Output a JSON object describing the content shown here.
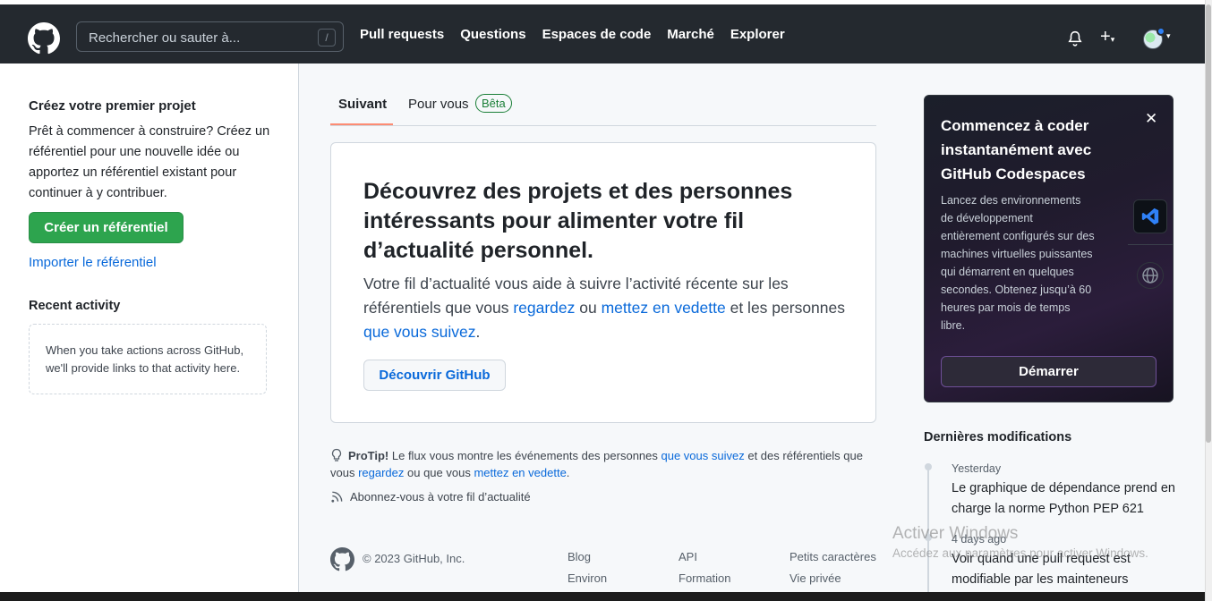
{
  "header": {
    "search_placeholder": "Rechercher ou sauter à...",
    "search_shortcut": "/",
    "nav": [
      "Pull requests",
      "Questions",
      "Espaces de code",
      "Marché",
      "Explorer"
    ],
    "plus": "+",
    "caret": "▾"
  },
  "left": {
    "title": "Créez votre premier projet",
    "text": "Prêt à commencer à construire? Créez un référentiel pour une nouvelle idée ou apportez un référentiel existant pour continuer à y contribuer.",
    "create_button": "Créer un référentiel",
    "import_link": "Importer le référentiel",
    "recent_title": "Recent activity",
    "recent_text": "When you take actions across GitHub, we'll provide links to that activity here."
  },
  "tabs": {
    "following": "Suivant",
    "for_you": "Pour vous",
    "beta": "Bêta"
  },
  "card": {
    "title": "Découvrez des projets et des personnes intéressants pour alimenter votre fil d’actualité personnel.",
    "body_1": "Votre fil d’actualité vous aide à suivre l’activité récente sur les référentiels que vous ",
    "link_watch": "regardez",
    "body_2": " ou ",
    "link_star": "mettez en vedette",
    "body_3": " et les personnes ",
    "link_follow": "que vous suivez",
    "body_4": ".",
    "button": "Découvrir GitHub"
  },
  "protip": {
    "label": "ProTip!",
    "text_1": " Le flux vous montre les événements des personnes ",
    "link_1": "que vous suivez",
    "text_2": " et des référentiels que vous ",
    "link_2": "regardez",
    "text_3": " ou que vous ",
    "link_3": "mettez en vedette",
    "text_4": ".",
    "rss": "Abonnez-vous à votre fil d’actualité"
  },
  "footer": {
    "copyright": "© 2023 GitHub, Inc.",
    "links": [
      "Blog",
      "API",
      "Petits caractères",
      "Environ",
      "Formation",
      "Vie privée"
    ]
  },
  "promo": {
    "title": "Commencez à coder instantanément avec GitHub Codespaces",
    "body": "Lancez des environnements de développement entièrement configurés sur des machines virtuelles puissantes qui démarrent en quelques secondes. Obtenez jusqu’à 60 heures par mois de temps libre.",
    "close": "✕",
    "button": "Démarrer"
  },
  "changes": {
    "title": "Dernières modifications",
    "items": [
      {
        "date": "Yesterday",
        "text": "Le graphique de dépendance prend en charge la norme Python PEP 621"
      },
      {
        "date": "4 days ago",
        "text": "Voir quand une pull request est modifiable par les mainteneurs"
      }
    ]
  },
  "watermark": {
    "line1": "Activer Windows",
    "line2": "Accédez aux paramètres pour activer Windows."
  },
  "colors": {
    "header_bg": "#24292f",
    "accent_green": "#2da44e",
    "link_blue": "#0969da",
    "tab_underline": "#fd8c73"
  }
}
